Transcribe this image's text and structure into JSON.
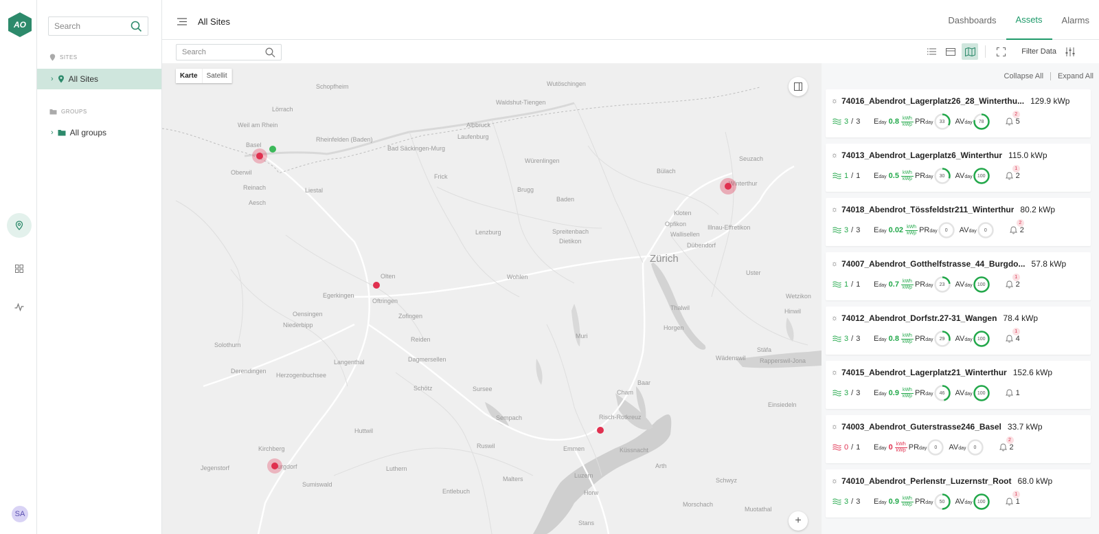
{
  "header": {
    "title": "All Sites",
    "tabs": [
      {
        "label": "Dashboards"
      },
      {
        "label": "Assets"
      },
      {
        "label": "Alarms"
      }
    ]
  },
  "rail": {
    "logo": "AO",
    "avatar": "SA"
  },
  "tree": {
    "search_placeholder": "Search",
    "sites_label": "SITES",
    "groups_label": "GROUPS",
    "all_sites": "All Sites",
    "all_groups": "All groups"
  },
  "toolbar": {
    "search_placeholder": "Search",
    "filter_label": "Filter Data"
  },
  "map": {
    "toggle": [
      "Karte",
      "Satellit"
    ],
    "labels": {
      "zurich": "Zürich",
      "basel": "Basel",
      "weil": "Weil am Rhein",
      "lorrach": "Lörrach",
      "schopfheim": "Schopfheim",
      "rheinfelden": "Rheinfelden (Baden)",
      "sackingen": "Bad Säckingen-Murg",
      "laufenburg": "Laufenburg",
      "waldshut": "Waldshut-Tiengen",
      "albbruck": "Albbruck",
      "wutoschingen": "Wutöschingen",
      "wurenlingen": "Würenlingen",
      "frick": "Frick",
      "brugg": "Brugg",
      "baden": "Baden",
      "bulach": "Bülach",
      "seuzach": "Seuzach",
      "winterthur": "Winterthur",
      "kloten": "Kloten",
      "opfikon": "Opfikon",
      "wallisellen": "Wallisellen",
      "dubendorf": "Dübendorf",
      "illnau": "Illnau-Effretikon",
      "spreitenbach": "Spreitenbach",
      "dietikon": "Dietikon",
      "lenzburg": "Lenzburg",
      "wohlen": "Wohlen",
      "olten": "Olten",
      "egerkingen": "Egerkingen",
      "oftringen": "Oftringen",
      "zofingen": "Zofingen",
      "oberwil": "Oberwil",
      "reinach": "Reinach",
      "aesch": "Aesch",
      "liestal": "Liestal",
      "oensingen": "Oensingen",
      "niederbipp": "Niederbipp",
      "langenthal": "Langenthal",
      "solothurn": "Solothurn",
      "derendingen": "Derendingen",
      "herzogenbuchsee": "Herzogenbuchsee",
      "reiden": "Reiden",
      "dagmersellen": "Dagmersellen",
      "schotz": "Schötz",
      "sursee": "Sursee",
      "sempach": "Sempach",
      "huttwil": "Huttwil",
      "ruswil": "Ruswil",
      "kirchberg": "Kirchberg",
      "burgdorf": "Burgdorf",
      "jegenstorf": "Jegenstorf",
      "sumiswald": "Sumiswald",
      "luthern": "Luthern",
      "malters": "Malters",
      "emmen": "Emmen",
      "luzern": "Luzern",
      "kussnacht": "Küssnacht",
      "arth": "Arth",
      "cham": "Cham",
      "baar": "Baar",
      "risch": "Risch-Rotkreuz",
      "muri": "Muri",
      "horgen": "Horgen",
      "thalwil": "Thalwil",
      "wadenswil": "Wädenswil",
      "uster": "Uster",
      "wetzikon": "Wetzikon",
      "hinwil": "Hinwil",
      "stafa": "Stäfa",
      "rapperswil": "Rapperswil-Jona",
      "einsiedeln": "Einsiedeln",
      "schwyz": "Schwyz",
      "entlebuch": "Entlebuch",
      "horw": "Horw",
      "morschach": "Morschach",
      "muotathal": "Muotathal",
      "stans": "Stans"
    }
  },
  "assets": {
    "collapse_all": "Collapse All",
    "expand_all": "Expand All",
    "labels": {
      "eday": "E",
      "day": "day",
      "pr": "PR",
      "av": "AV",
      "kwh": "kWh",
      "kwp": "kWp"
    },
    "items": [
      {
        "name": "74016_Abendrot_Lagerplatz26_28_Winterthu...",
        "kwp": "129.9 kWp",
        "strings_ok": "3",
        "strings_total": "3",
        "eday": "0.8",
        "pr": "33",
        "av": "78",
        "alarms": "5",
        "badge": "2",
        "status": "ok"
      },
      {
        "name": "74013_Abendrot_Lagerplatz6_Winterthur",
        "kwp": "115.0 kWp",
        "strings_ok": "1",
        "strings_total": "1",
        "eday": "0.5",
        "pr": "30",
        "av": "100",
        "alarms": "2",
        "badge": "1",
        "status": "ok"
      },
      {
        "name": "74018_Abendrot_Tössfeldstr211_Winterthur",
        "kwp": "80.2 kWp",
        "strings_ok": "3",
        "strings_total": "3",
        "eday": "0.02",
        "pr": "0",
        "av": "0",
        "alarms": "2",
        "badge": "2",
        "status": "ok"
      },
      {
        "name": "74007_Abendrot_Gotthelfstrasse_44_Burgdo...",
        "kwp": "57.8 kWp",
        "strings_ok": "1",
        "strings_total": "1",
        "eday": "0.7",
        "pr": "23",
        "av": "100",
        "alarms": "2",
        "badge": "1",
        "status": "ok"
      },
      {
        "name": "74012_Abendrot_Dorfstr.27-31_Wangen",
        "kwp": "78.4 kWp",
        "strings_ok": "3",
        "strings_total": "3",
        "eday": "0.8",
        "pr": "29",
        "av": "100",
        "alarms": "4",
        "badge": "1",
        "status": "ok"
      },
      {
        "name": "74015_Abendrot_Lagerplatz21_Winterthur",
        "kwp": "152.6 kWp",
        "strings_ok": "3",
        "strings_total": "3",
        "eday": "0.9",
        "pr": "46",
        "av": "100",
        "alarms": "1",
        "badge": "",
        "status": "ok"
      },
      {
        "name": "74003_Abendrot_Guterstrasse246_Basel",
        "kwp": "33.7 kWp",
        "strings_ok": "0",
        "strings_total": "1",
        "eday": "0",
        "pr": "0",
        "av": "0",
        "alarms": "2",
        "badge": "2",
        "status": "bad"
      },
      {
        "name": "74010_Abendrot_Perlenstr_Luzernstr_Root",
        "kwp": "68.0 kWp",
        "strings_ok": "3",
        "strings_total": "3",
        "eday": "0.9",
        "pr": "50",
        "av": "100",
        "alarms": "1",
        "badge": "1",
        "status": "ok"
      }
    ]
  },
  "colors": {
    "accent": "#1e9a6a",
    "ok": "#22a84a",
    "bad": "#e0304f",
    "selected_bg": "#cfe6dd"
  }
}
